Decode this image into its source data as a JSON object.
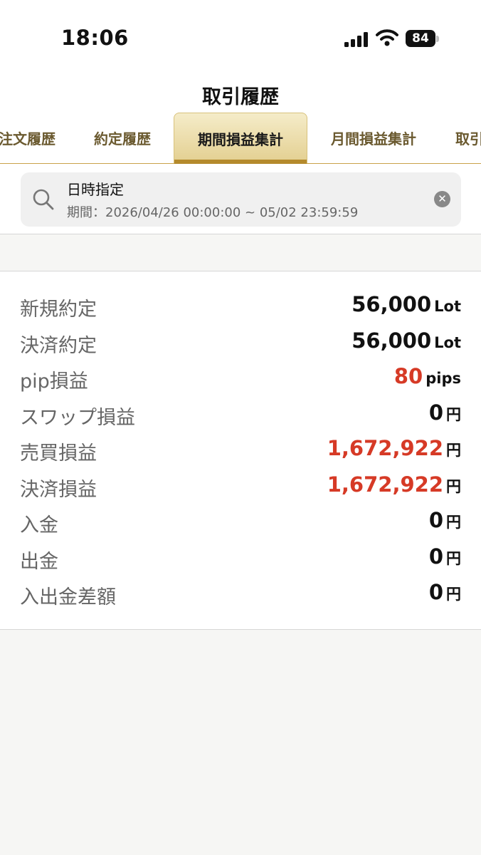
{
  "status_bar": {
    "time": "18:06",
    "battery": "84"
  },
  "header": {
    "title": "取引履歴",
    "tabs": [
      {
        "label": "注文履歴"
      },
      {
        "label": "約定履歴"
      },
      {
        "label": "期間損益集計",
        "active": true
      },
      {
        "label": "月間損益集計"
      },
      {
        "label": "取引"
      }
    ]
  },
  "search": {
    "label": "日時指定",
    "range": "期間：2026/04/26 00:00:00 ~ 05/02 23:59:59"
  },
  "summary": [
    {
      "label": "新規約定",
      "value": "56,000",
      "unit": "Lot",
      "color": "#111111"
    },
    {
      "label": "決済約定",
      "value": "56,000",
      "unit": "Lot",
      "color": "#111111"
    },
    {
      "label": "pip損益",
      "value": "80",
      "unit": "pips",
      "color": "#d63a26"
    },
    {
      "label": "スワップ損益",
      "value": "0",
      "unit": "円",
      "color": "#111111"
    },
    {
      "label": "売買損益",
      "value": "1,672,922",
      "unit": "円",
      "color": "#d63a26"
    },
    {
      "label": "決済損益",
      "value": "1,672,922",
      "unit": "円",
      "color": "#d63a26"
    },
    {
      "label": "入金",
      "value": "0",
      "unit": "円",
      "color": "#111111"
    },
    {
      "label": "出金",
      "value": "0",
      "unit": "円",
      "color": "#111111"
    },
    {
      "label": "入出金差額",
      "value": "0",
      "unit": "円",
      "color": "#111111"
    }
  ],
  "colors": {
    "accent_gold": "#c9a24a",
    "profit_red": "#d63a26"
  }
}
